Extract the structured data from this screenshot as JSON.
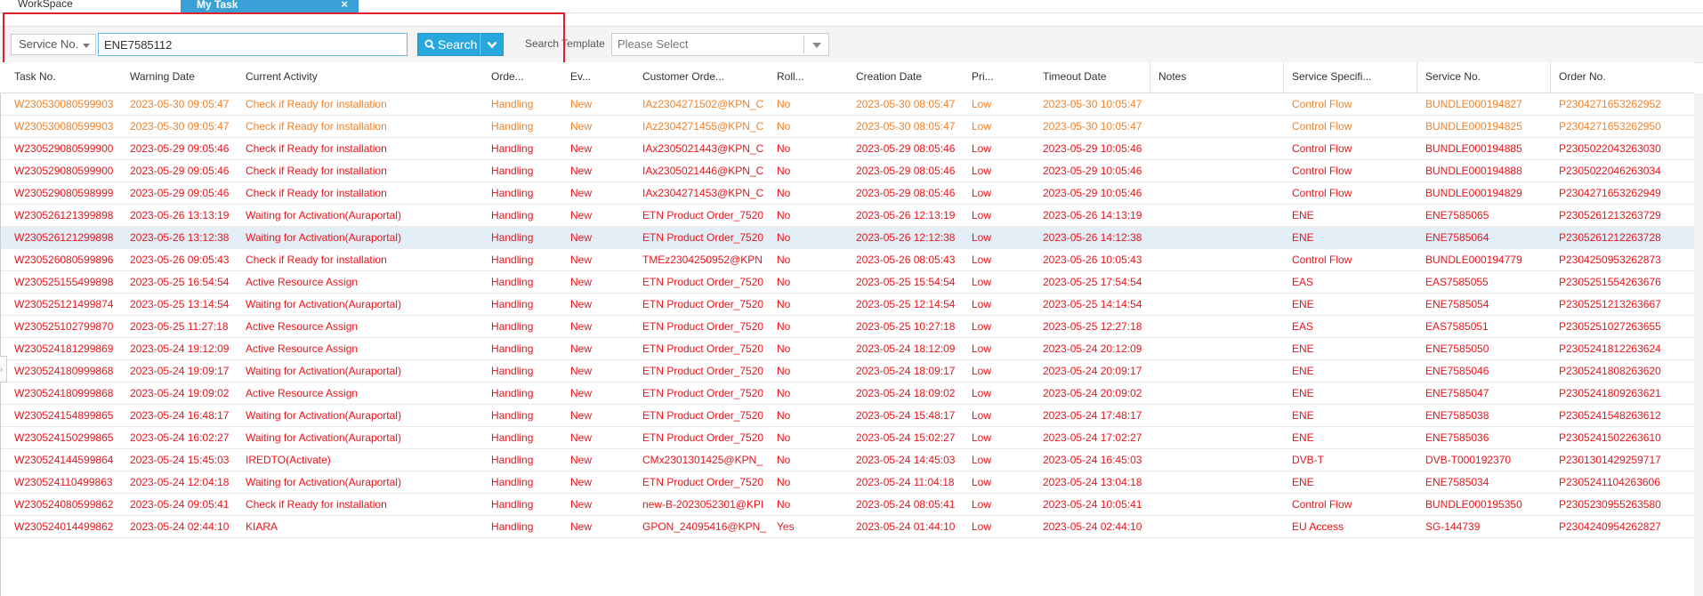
{
  "tabs": {
    "workspace": "WorkSpace",
    "mytask": "My Task",
    "close": "×"
  },
  "search": {
    "field_label": "Service No.",
    "value": "ENE7585112",
    "button_label": "Search",
    "template_label": "Search Template",
    "template_placeholder": "Please Select"
  },
  "columns": [
    "Task No.",
    "Warning Date",
    "Current Activity",
    "Orde...",
    "Ev...",
    "Customer Orde...",
    "Roll...",
    "Creation Date",
    "Pri...",
    "Timeout Date",
    "Notes",
    "Service Specifi...",
    "Service No.",
    "Order No."
  ],
  "colors": {
    "orange": "#f0822a",
    "red": "#e8151b",
    "accent": "#29a8dd",
    "highlight": "#e0202a"
  },
  "rows": [
    {
      "color": "orange",
      "cells": [
        "W230530080599903",
        "2023-05-30 09:05:47",
        "Check if Ready for installation",
        "Handling",
        "New",
        "IAz2304271502@KPN_C",
        "No",
        "2023-05-30 08:05:47",
        "Low",
        "2023-05-30 10:05:47",
        "",
        "Control Flow",
        "BUNDLE000194827",
        "P2304271653262952"
      ]
    },
    {
      "color": "orange",
      "cells": [
        "W230530080599903",
        "2023-05-30 09:05:47",
        "Check if Ready for installation",
        "Handling",
        "New",
        "IAz2304271455@KPN_C",
        "No",
        "2023-05-30 08:05:47",
        "Low",
        "2023-05-30 10:05:47",
        "",
        "Control Flow",
        "BUNDLE000194825",
        "P2304271653262950"
      ]
    },
    {
      "color": "red",
      "cells": [
        "W230529080599900",
        "2023-05-29 09:05:46",
        "Check if Ready for installation",
        "Handling",
        "New",
        "IAx2305021443@KPN_C",
        "No",
        "2023-05-29 08:05:46",
        "Low",
        "2023-05-29 10:05:46",
        "",
        "Control Flow",
        "BUNDLE000194885",
        "P2305022043263030"
      ]
    },
    {
      "color": "red",
      "cells": [
        "W230529080599900",
        "2023-05-29 09:05:46",
        "Check if Ready for installation",
        "Handling",
        "New",
        "IAx2305021446@KPN_C",
        "No",
        "2023-05-29 08:05:46",
        "Low",
        "2023-05-29 10:05:46",
        "",
        "Control Flow",
        "BUNDLE000194888",
        "P2305022046263034"
      ]
    },
    {
      "color": "red",
      "cells": [
        "W230529080598999",
        "2023-05-29 09:05:46",
        "Check if Ready for installation",
        "Handling",
        "New",
        "IAx2304271453@KPN_C",
        "No",
        "2023-05-29 08:05:46",
        "Low",
        "2023-05-29 10:05:46",
        "",
        "Control Flow",
        "BUNDLE000194829",
        "P2304271653262949"
      ]
    },
    {
      "color": "red",
      "cells": [
        "W230526121399898",
        "2023-05-26 13:13:19",
        "Waiting for Activation(Auraportal)",
        "Handling",
        "New",
        "ETN Product Order_7520",
        "No",
        "2023-05-26 12:13:19",
        "Low",
        "2023-05-26 14:13:19",
        "",
        "ENE",
        "ENE7585065",
        "P2305261213263729"
      ]
    },
    {
      "color": "red",
      "cells": [
        "W230526121299898",
        "2023-05-26 13:12:38",
        "Waiting for Activation(Auraportal)",
        "Handling",
        "New",
        "ETN Product Order_7520",
        "No",
        "2023-05-26 12:12:38",
        "Low",
        "2023-05-26 14:12:38",
        "",
        "ENE",
        "ENE7585064",
        "P2305261212263728"
      ],
      "selected": true
    },
    {
      "color": "red",
      "cells": [
        "W230526080599896",
        "2023-05-26 09:05:43",
        "Check if Ready for installation",
        "Handling",
        "New",
        "TMEz2304250952@KPN",
        "No",
        "2023-05-26 08:05:43",
        "Low",
        "2023-05-26 10:05:43",
        "",
        "Control Flow",
        "BUNDLE000194779",
        "P2304250953262873"
      ]
    },
    {
      "color": "red",
      "cells": [
        "W230525155499898",
        "2023-05-25 16:54:54",
        "Active Resource Assign",
        "Handling",
        "New",
        "ETN Product Order_7520",
        "No",
        "2023-05-25 15:54:54",
        "Low",
        "2023-05-25 17:54:54",
        "",
        "EAS",
        "EAS7585055",
        "P2305251554263676"
      ]
    },
    {
      "color": "red",
      "cells": [
        "W230525121499874",
        "2023-05-25 13:14:54",
        "Waiting for Activation(Auraportal)",
        "Handling",
        "New",
        "ETN Product Order_7520",
        "No",
        "2023-05-25 12:14:54",
        "Low",
        "2023-05-25 14:14:54",
        "",
        "ENE",
        "ENE7585054",
        "P2305251213263667"
      ]
    },
    {
      "color": "red",
      "cells": [
        "W230525102799870",
        "2023-05-25 11:27:18",
        "Active Resource Assign",
        "Handling",
        "New",
        "ETN Product Order_7520",
        "No",
        "2023-05-25 10:27:18",
        "Low",
        "2023-05-25 12:27:18",
        "",
        "EAS",
        "EAS7585051",
        "P2305251027263655"
      ]
    },
    {
      "color": "red",
      "cells": [
        "W230524181299869",
        "2023-05-24 19:12:09",
        "Active Resource Assign",
        "Handling",
        "New",
        "ETN Product Order_7520",
        "No",
        "2023-05-24 18:12:09",
        "Low",
        "2023-05-24 20:12:09",
        "",
        "ENE",
        "ENE7585050",
        "P2305241812263624"
      ]
    },
    {
      "color": "red",
      "cells": [
        "W230524180999868",
        "2023-05-24 19:09:17",
        "Waiting for Activation(Auraportal)",
        "Handling",
        "New",
        "ETN Product Order_7520",
        "No",
        "2023-05-24 18:09:17",
        "Low",
        "2023-05-24 20:09:17",
        "",
        "ENE",
        "ENE7585046",
        "P2305241808263620"
      ]
    },
    {
      "color": "red",
      "cells": [
        "W230524180999868",
        "2023-05-24 19:09:02",
        "Active Resource Assign",
        "Handling",
        "New",
        "ETN Product Order_7520",
        "No",
        "2023-05-24 18:09:02",
        "Low",
        "2023-05-24 20:09:02",
        "",
        "ENE",
        "ENE7585047",
        "P2305241809263621"
      ]
    },
    {
      "color": "red",
      "cells": [
        "W230524154899865",
        "2023-05-24 16:48:17",
        "Waiting for Activation(Auraportal)",
        "Handling",
        "New",
        "ETN Product Order_7520",
        "No",
        "2023-05-24 15:48:17",
        "Low",
        "2023-05-24 17:48:17",
        "",
        "ENE",
        "ENE7585038",
        "P2305241548263612"
      ]
    },
    {
      "color": "red",
      "cells": [
        "W230524150299865",
        "2023-05-24 16:02:27",
        "Waiting for Activation(Auraportal)",
        "Handling",
        "New",
        "ETN Product Order_7520",
        "No",
        "2023-05-24 15:02:27",
        "Low",
        "2023-05-24 17:02:27",
        "",
        "ENE",
        "ENE7585036",
        "P2305241502263610"
      ]
    },
    {
      "color": "red",
      "cells": [
        "W230524144599864",
        "2023-05-24 15:45:03",
        "IREDTO(Activate)",
        "Handling",
        "New",
        "CMx2301301425@KPN_",
        "No",
        "2023-05-24 14:45:03",
        "Low",
        "2023-05-24 16:45:03",
        "",
        "DVB-T",
        "DVB-T000192370",
        "P2301301429259717"
      ]
    },
    {
      "color": "red",
      "cells": [
        "W230524110499863",
        "2023-05-24 12:04:18",
        "Waiting for Activation(Auraportal)",
        "Handling",
        "New",
        "ETN Product Order_7520",
        "No",
        "2023-05-24 11:04:18",
        "Low",
        "2023-05-24 13:04:18",
        "",
        "ENE",
        "ENE7585034",
        "P2305241104263606"
      ]
    },
    {
      "color": "red",
      "cells": [
        "W230524080599862",
        "2023-05-24 09:05:41",
        "Check if Ready for installation",
        "Handling",
        "New",
        "new-B-2023052301@KPI",
        "No",
        "2023-05-24 08:05:41",
        "Low",
        "2023-05-24 10:05:41",
        "",
        "Control Flow",
        "BUNDLE000195350",
        "P2305230955263580"
      ]
    },
    {
      "color": "red",
      "cells": [
        "W230524014499862",
        "2023-05-24 02:44:10",
        "KIARA",
        "Handling",
        "New",
        "GPON_24095416@KPN_",
        "Yes",
        "2023-05-24 01:44:10",
        "Low",
        "2023-05-24 02:44:10",
        "",
        "EU Access",
        "SG-144739",
        "P2304240954262827"
      ]
    }
  ]
}
